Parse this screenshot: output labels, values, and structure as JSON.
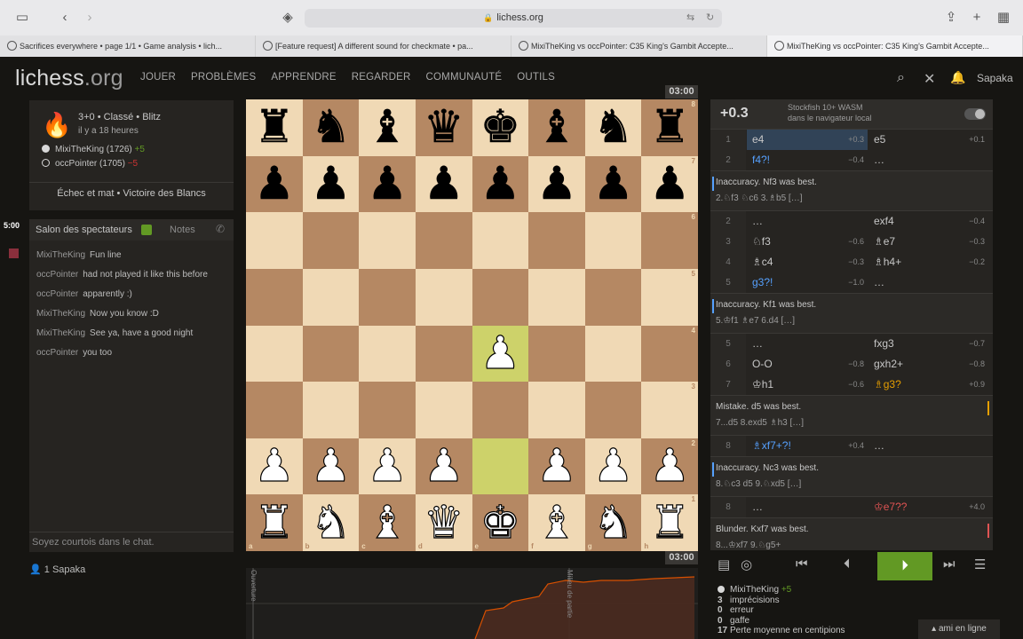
{
  "browser": {
    "url": "lichess.org",
    "tabs": [
      "Sacrifices everywhere • page 1/1 • Game analysis • lich...",
      "[Feature request] A different sound for checkmate • pa...",
      "MixiTheKing vs occPointer: C35 King's Gambit Accepte...",
      "MixiTheKing vs occPointer: C35 King's Gambit Accepte..."
    ]
  },
  "header": {
    "logo_main": "lichess",
    "logo_tld": ".org",
    "nav": [
      "JOUER",
      "PROBLÈMES",
      "APPRENDRE",
      "REGARDER",
      "COMMUNAUTÉ",
      "OUTILS"
    ],
    "username": "Sapaka"
  },
  "game": {
    "meta": "3+0 • Classé • Blitz",
    "time_ago": "il y a 18 heures",
    "white_name": "MixiTheKing (1726)",
    "white_diff": "+5",
    "black_name": "occPointer (1705)",
    "black_diff": "−5",
    "result": "Échec et mat • Victoire des Blancs",
    "side_clock": "5:00"
  },
  "chat": {
    "tab_room": "Salon des spectateurs",
    "tab_notes": "Notes",
    "input_placeholder": "Soyez courtois dans le chat.",
    "lines": [
      {
        "user": "MixiTheKing",
        "text": "Fun line"
      },
      {
        "user": "occPointer",
        "text": "had not played it like this before"
      },
      {
        "user": "occPointer",
        "text": "apparently :)"
      },
      {
        "user": "MixiTheKing",
        "text": "Now you know :D"
      },
      {
        "user": "MixiTheKing",
        "text": "See ya, have a good night"
      },
      {
        "user": "occPointer",
        "text": "you too"
      }
    ]
  },
  "spectators": "1  Sapaka",
  "clocks": {
    "top": "03:00",
    "bottom": "03:00"
  },
  "board": {
    "ranks": [
      "rnbqkbnr",
      "pppppppp",
      "........",
      "........",
      "....P...",
      "........",
      "PPPP.PPP",
      "RNBQKBNR"
    ],
    "highlight": [
      "e4",
      "e2"
    ],
    "files": [
      "a",
      "b",
      "c",
      "d",
      "e",
      "f",
      "g",
      "h"
    ]
  },
  "graph": {
    "labels": [
      "Ouverture",
      "Milieu de partie"
    ]
  },
  "engine": {
    "score": "+0.3",
    "name": "Stockfish 10+ WASM",
    "location": "dans le navigateur local"
  },
  "moves": [
    {
      "type": "row",
      "num": "1",
      "w": "e4",
      "we": "+0.3",
      "b": "e5",
      "be": "+0.1",
      "sel": true
    },
    {
      "type": "row",
      "num": "2",
      "w": "f4?!",
      "we": "−0.4",
      "wc": "inacc",
      "b": "…",
      "be": ""
    },
    {
      "type": "comment",
      "text": "Inaccuracy. Nf3 was best.",
      "sub": "2.♘f3 ♘c6 3.♗b5 […]",
      "bar": "#56a1ff"
    },
    {
      "type": "row",
      "num": "2",
      "w": "…",
      "we": "",
      "b": "exf4",
      "be": "−0.4"
    },
    {
      "type": "row",
      "num": "3",
      "w": "♘f3",
      "we": "−0.6",
      "b": "♗e7",
      "be": "−0.3"
    },
    {
      "type": "row",
      "num": "4",
      "w": "♗c4",
      "we": "−0.3",
      "b": "♗h4+",
      "be": "−0.2"
    },
    {
      "type": "row",
      "num": "5",
      "w": "g3?!",
      "we": "−1.0",
      "wc": "inacc",
      "b": "…",
      "be": ""
    },
    {
      "type": "comment",
      "text": "Inaccuracy. Kf1 was best.",
      "sub": "5.♔f1 ♗e7 6.d4 […]",
      "bar": "#56a1ff"
    },
    {
      "type": "row",
      "num": "5",
      "w": "…",
      "we": "",
      "b": "fxg3",
      "be": "−0.7"
    },
    {
      "type": "row",
      "num": "6",
      "w": "O-O",
      "we": "−0.8",
      "b": "gxh2+",
      "be": "−0.8"
    },
    {
      "type": "row",
      "num": "7",
      "w": "♔h1",
      "we": "−0.6",
      "b": "♗g3?",
      "be": "+0.9",
      "bc": "mist"
    },
    {
      "type": "comment",
      "text": "Mistake. d5 was best.",
      "sub": "7...d5 8.exd5 ♗h3 […]",
      "bar": "#e69f00",
      "right": true
    },
    {
      "type": "row",
      "num": "8",
      "w": "♗xf7+?!",
      "we": "+0.4",
      "wc": "inacc",
      "b": "…",
      "be": ""
    },
    {
      "type": "comment",
      "text": "Inaccuracy. Nc3 was best.",
      "sub": "8.♘c3 d5 9.♘xd5 […]",
      "bar": "#56a1ff"
    },
    {
      "type": "row",
      "num": "8",
      "w": "…",
      "we": "",
      "b": "♔e7??",
      "be": "+4.0",
      "bc": "blund"
    },
    {
      "type": "comment",
      "text": "Blunder. Kxf7 was best.",
      "sub": "8...♔xf7 9.♘g5+",
      "bar": "#df5353",
      "right": true
    }
  ],
  "summary": {
    "player": "MixiTheKing",
    "diff": "+5",
    "stats": [
      {
        "n": "3",
        "label": "imprécisions"
      },
      {
        "n": "0",
        "label": "erreur"
      },
      {
        "n": "0",
        "label": "gaffe"
      },
      {
        "n": "17",
        "label": "Perte moyenne en centipions"
      }
    ]
  },
  "online": "ami en ligne",
  "colors": {
    "accent": "#629924",
    "light_square": "#f0d9b5",
    "dark_square": "#b58863",
    "highlight": "#cdd26a"
  }
}
